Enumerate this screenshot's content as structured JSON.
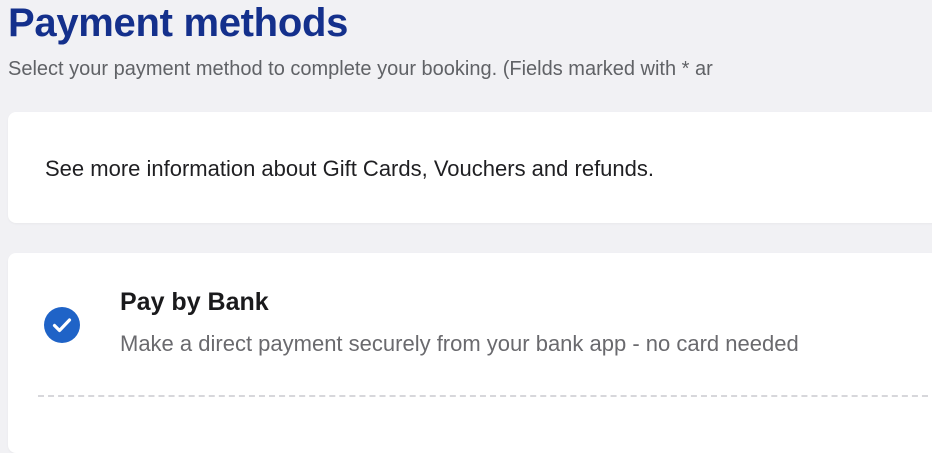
{
  "header": {
    "title": "Payment methods",
    "subtitle": "Select your payment method to complete your booking.   (Fields marked with * ar"
  },
  "info_card": {
    "text": "See more information about Gift Cards, Vouchers and refunds."
  },
  "payment_options": [
    {
      "title": "Pay by Bank",
      "description": "Make a direct payment securely from your bank app - no card needed",
      "selected": true,
      "icon": "check-circle-icon"
    }
  ],
  "colors": {
    "title": "#14308c",
    "accent": "#1f63c7",
    "background": "#f1f1f4",
    "card": "#ffffff"
  }
}
